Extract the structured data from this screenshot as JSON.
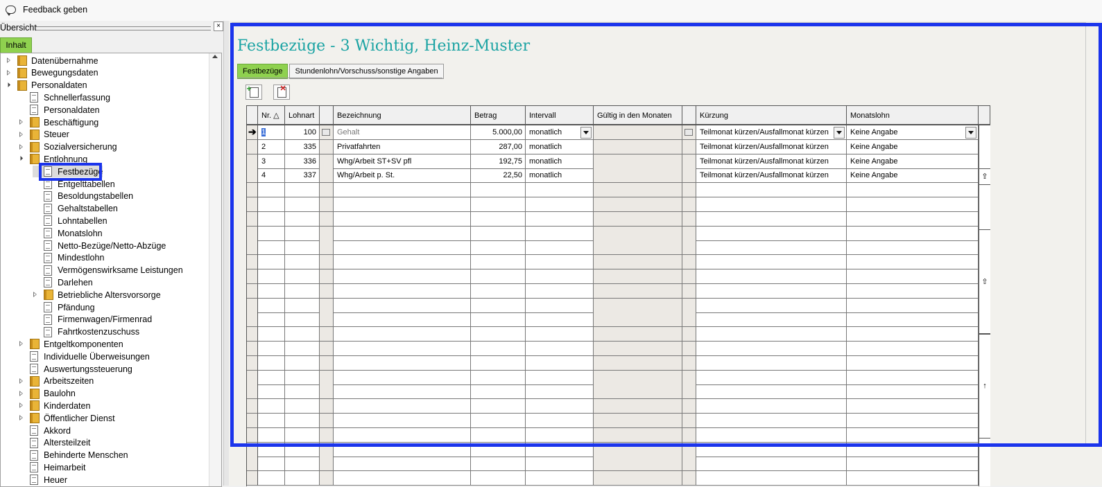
{
  "topbar": {
    "feedback_label": "Feedback geben"
  },
  "left": {
    "panel_title": "Übersicht",
    "close_label": "×",
    "tab_label": "Inhalt",
    "tree": [
      {
        "label": "Datenübernahme",
        "level": 0,
        "icon": "folder-icon",
        "exp": "closed"
      },
      {
        "label": "Bewegungsdaten",
        "level": 0,
        "icon": "folder-icon",
        "exp": "closed"
      },
      {
        "label": "Personaldaten",
        "level": 0,
        "icon": "folder-icon",
        "exp": "open"
      },
      {
        "label": "Schnellerfassung",
        "level": 1,
        "icon": "document-icon",
        "exp": "none"
      },
      {
        "label": "Personaldaten",
        "level": 1,
        "icon": "document-icon",
        "exp": "none"
      },
      {
        "label": "Beschäftigung",
        "level": 1,
        "icon": "folder-icon",
        "exp": "closed"
      },
      {
        "label": "Steuer",
        "level": 1,
        "icon": "folder-icon",
        "exp": "closed"
      },
      {
        "label": "Sozialversicherung",
        "level": 1,
        "icon": "folder-icon",
        "exp": "closed"
      },
      {
        "label": "Entlohnung",
        "level": 1,
        "icon": "folder-icon",
        "exp": "open"
      },
      {
        "label": "Festbezüge",
        "level": 2,
        "icon": "document-icon",
        "exp": "none",
        "selected": true
      },
      {
        "label": "Entgelttabellen",
        "level": 2,
        "icon": "document-icon",
        "exp": "none"
      },
      {
        "label": "Besoldungstabellen",
        "level": 2,
        "icon": "document-icon",
        "exp": "none"
      },
      {
        "label": "Gehaltstabellen",
        "level": 2,
        "icon": "document-icon",
        "exp": "none"
      },
      {
        "label": "Lohntabellen",
        "level": 2,
        "icon": "document-icon",
        "exp": "none"
      },
      {
        "label": "Monatslohn",
        "level": 2,
        "icon": "document-icon",
        "exp": "none"
      },
      {
        "label": "Netto-Bezüge/Netto-Abzüge",
        "level": 2,
        "icon": "document-icon",
        "exp": "none"
      },
      {
        "label": "Mindestlohn",
        "level": 2,
        "icon": "document-icon",
        "exp": "none"
      },
      {
        "label": "Vermögenswirksame Leistungen",
        "level": 2,
        "icon": "document-icon",
        "exp": "none"
      },
      {
        "label": "Darlehen",
        "level": 2,
        "icon": "document-icon",
        "exp": "none"
      },
      {
        "label": "Betriebliche Altersvorsorge",
        "level": 2,
        "icon": "folder-icon",
        "exp": "closed"
      },
      {
        "label": "Pfändung",
        "level": 2,
        "icon": "document-icon",
        "exp": "none"
      },
      {
        "label": "Firmenwagen/Firmenrad",
        "level": 2,
        "icon": "document-icon",
        "exp": "none"
      },
      {
        "label": "Fahrtkostenzuschuss",
        "level": 2,
        "icon": "document-icon",
        "exp": "none"
      },
      {
        "label": "Entgeltkomponenten",
        "level": 1,
        "icon": "folder-icon",
        "exp": "closed"
      },
      {
        "label": "Individuelle Überweisungen",
        "level": 1,
        "icon": "document-icon",
        "exp": "none"
      },
      {
        "label": "Auswertungssteuerung",
        "level": 1,
        "icon": "document-icon",
        "exp": "none"
      },
      {
        "label": "Arbeitszeiten",
        "level": 1,
        "icon": "folder-icon",
        "exp": "closed"
      },
      {
        "label": "Baulohn",
        "level": 1,
        "icon": "folder-icon",
        "exp": "closed"
      },
      {
        "label": "Kinderdaten",
        "level": 1,
        "icon": "folder-icon",
        "exp": "closed"
      },
      {
        "label": "Öffentlicher Dienst",
        "level": 1,
        "icon": "folder-icon",
        "exp": "closed"
      },
      {
        "label": "Akkord",
        "level": 1,
        "icon": "document-icon",
        "exp": "none"
      },
      {
        "label": "Altersteilzeit",
        "level": 1,
        "icon": "document-icon",
        "exp": "none"
      },
      {
        "label": "Behinderte Menschen",
        "level": 1,
        "icon": "document-icon",
        "exp": "none"
      },
      {
        "label": "Heimarbeit",
        "level": 1,
        "icon": "document-icon",
        "exp": "none"
      },
      {
        "label": "Heuer",
        "level": 1,
        "icon": "document-icon",
        "exp": "none"
      }
    ]
  },
  "main": {
    "title": "Festbezüge - 3 Wichtig, Heinz-Muster",
    "tabs": [
      {
        "label": "Festbezüge",
        "active": true
      },
      {
        "label": "Stundenlohn/Vorschuss/sonstige Angaben",
        "active": false
      }
    ],
    "toolbar": {
      "new_icon": "new-row-icon",
      "delete_icon": "delete-row-icon"
    },
    "columns": [
      "Nr.",
      "Lohnart",
      "",
      "Bezeichnung",
      "Betrag",
      "Intervall",
      "Gültig in den Monaten",
      "",
      "Kürzung",
      "Monatslohn"
    ],
    "rows": [
      {
        "nr": "1",
        "lohnart": "100",
        "bezeichnung": "Gehalt",
        "betrag": "5.000,00",
        "intervall": "monatlich",
        "gueltig": "",
        "kuerzung": "Teilmonat kürzen/Ausfallmonat kürzen",
        "monatslohn": "Keine Angabe"
      },
      {
        "nr": "2",
        "lohnart": "335",
        "bezeichnung": "Privatfahrten",
        "betrag": "287,00",
        "intervall": "monatlich",
        "gueltig": "",
        "kuerzung": "Teilmonat kürzen/Ausfallmonat kürzen",
        "monatslohn": "Keine Angabe"
      },
      {
        "nr": "3",
        "lohnart": "336",
        "bezeichnung": "Whg/Arbeit ST+SV pfl",
        "betrag": "192,75",
        "intervall": "monatlich",
        "gueltig": "",
        "kuerzung": "Teilmonat kürzen/Ausfallmonat kürzen",
        "monatslohn": "Keine Angabe"
      },
      {
        "nr": "4",
        "lohnart": "337",
        "bezeichnung": "Whg/Arbeit p. St.",
        "betrag": "22,50",
        "intervall": "monatlich",
        "gueltig": "",
        "kuerzung": "Teilmonat kürzen/Ausfallmonat kürzen",
        "monatslohn": "Keine Angabe"
      }
    ],
    "empty_rows": 21
  }
}
